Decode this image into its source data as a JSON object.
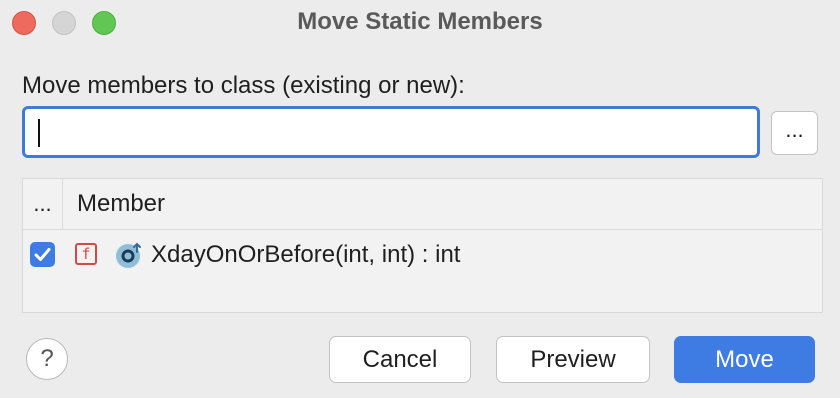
{
  "window": {
    "title": "Move Static Members",
    "controls": {
      "close": "close-button",
      "minimize": "minimize-button",
      "maximize": "maximize-button"
    }
  },
  "form": {
    "prompt": "Move members to class (existing or new):",
    "input_value": "",
    "browse_label": "..."
  },
  "table": {
    "col_check": "...",
    "col_member": "Member",
    "rows": [
      {
        "checked": true,
        "modifier_icon": "final-icon",
        "type_icon": "static-method-icon",
        "member": "XdayOnOrBefore(int, int) : int"
      }
    ]
  },
  "footer": {
    "help_label": "?",
    "cancel_label": "Cancel",
    "preview_label": "Preview",
    "move_label": "Move"
  },
  "colors": {
    "accent": "#3e7ce3",
    "final_icon": "#d14a4a"
  }
}
